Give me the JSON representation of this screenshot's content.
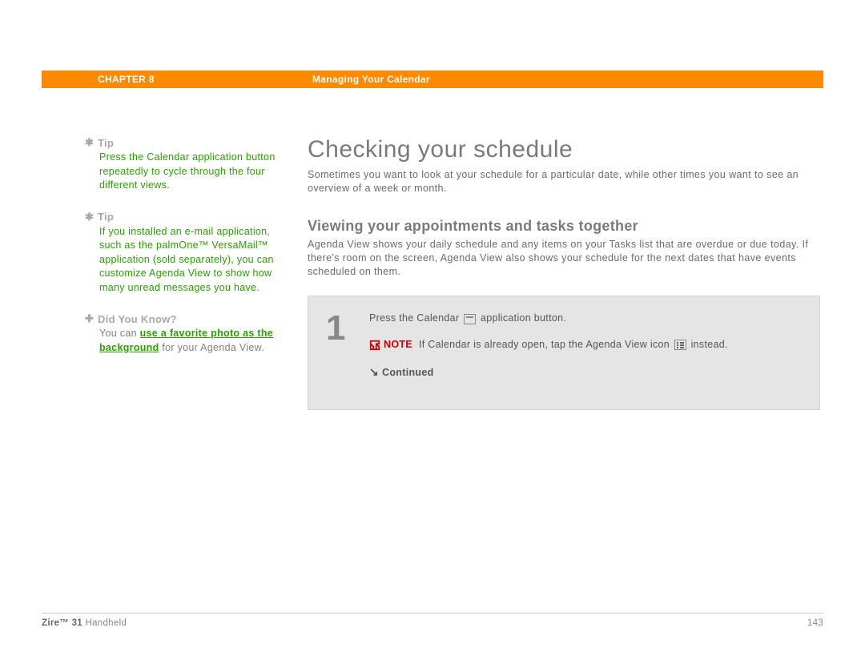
{
  "header": {
    "chapter": "CHAPTER 8",
    "section": "Managing Your Calendar"
  },
  "sidebar": {
    "tips": [
      {
        "icon": "✱",
        "label": "Tip",
        "body": "Press the Calendar application button repeatedly to cycle through the four different views."
      },
      {
        "icon": "✱",
        "label": "Tip",
        "body": "If you installed an e-mail application, such as the palmOne™ VersaMail™ application (sold separately), you can customize Agenda View to show how many unread messages you have."
      }
    ],
    "dyk": {
      "icon": "✚",
      "label": "Did You Know?",
      "pre": "You can ",
      "link": "use a favorite photo as the background",
      "post": " for your Agenda View."
    }
  },
  "main": {
    "h1": "Checking your schedule",
    "p1": "Sometimes you want to look at your schedule for a particular date, while other times you want to see an overview of a week or month.",
    "h2": "Viewing your appointments and tasks together",
    "p2": "Agenda View shows your daily schedule and any items on your Tasks list that are overdue or due today. If there's room on the screen, Agenda View also shows your schedule for the next dates that have events scheduled on them.",
    "step": {
      "num": "1",
      "line1a": "Press the Calendar ",
      "line1b": " application button.",
      "noteLabel": "NOTE",
      "noteText1": "If Calendar is already open, tap the Agenda View icon ",
      "noteText2": " instead.",
      "continued": "Continued"
    }
  },
  "footer": {
    "product_bold": "Zire™ 31",
    "product_rest": " Handheld",
    "page": "143"
  }
}
